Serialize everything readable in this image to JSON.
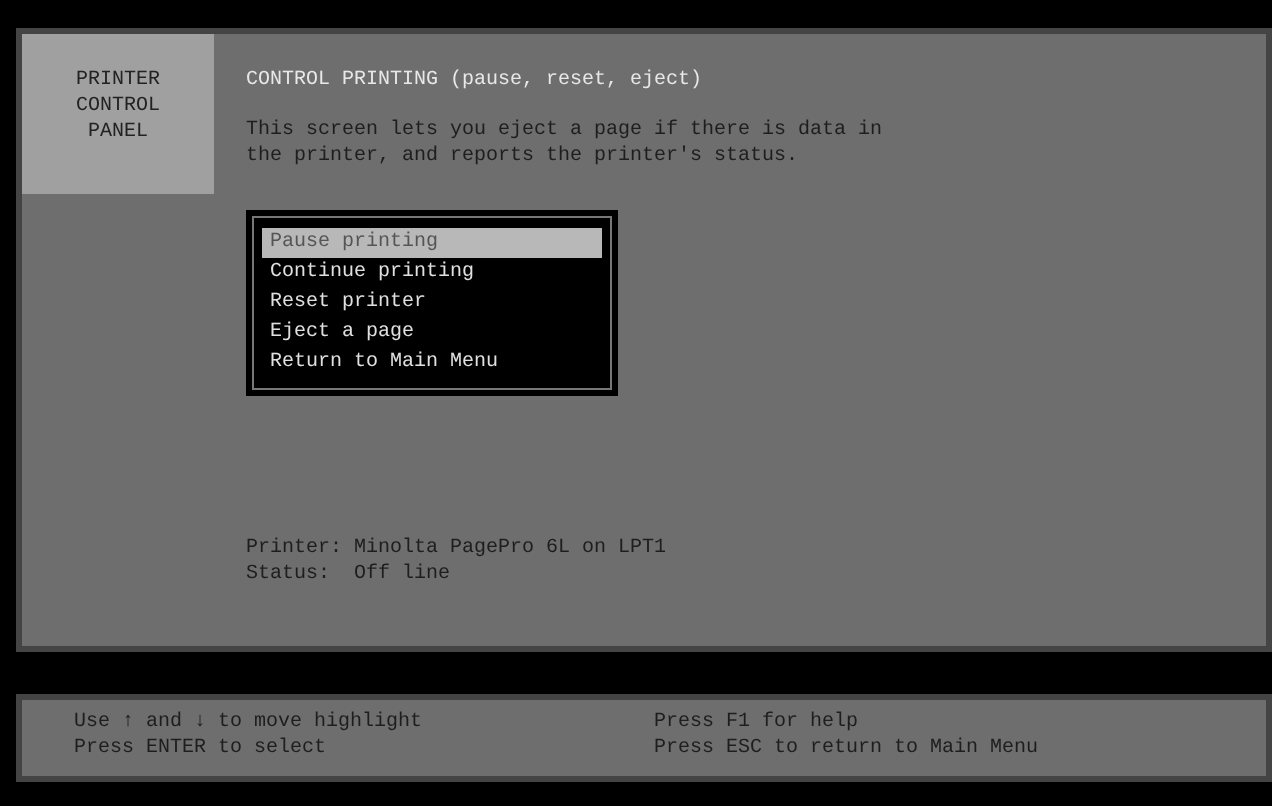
{
  "side_panel": {
    "lines": [
      "PRINTER",
      "CONTROL",
      "PANEL"
    ]
  },
  "heading": "CONTROL PRINTING (pause, reset, eject)",
  "description": [
    "This screen lets you eject a page if there is data in",
    "the printer, and reports the printer's status."
  ],
  "menu": [
    {
      "label": "Pause printing",
      "selected": true
    },
    {
      "label": "Continue printing",
      "selected": false
    },
    {
      "label": "Reset printer",
      "selected": false
    },
    {
      "label": "Eject a page",
      "selected": false
    },
    {
      "label": "Return to Main Menu",
      "selected": false
    }
  ],
  "info": [
    "Printer: Minolta PagePro 6L on LPT1",
    "Status:  Off line"
  ],
  "help_bar": {
    "left": [
      "Use ↑ and ↓ to move highlight",
      "Press ENTER to select"
    ],
    "right": [
      "Press F1 for help",
      "Press ESC to return to Main Menu"
    ]
  }
}
